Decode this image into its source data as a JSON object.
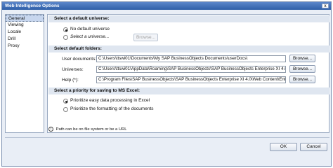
{
  "window": {
    "title": "Web Intelligence Options",
    "close_glyph": "x"
  },
  "sidebar": {
    "items": [
      {
        "label": "General"
      },
      {
        "label": "Viewing"
      },
      {
        "label": "Locale"
      },
      {
        "label": "Drill"
      },
      {
        "label": "Proxy"
      }
    ]
  },
  "universe": {
    "heading": "Select a default universe:",
    "no_default_label": "No default universe",
    "select_label": "Select a universe...",
    "browse_label": "Browse..."
  },
  "folders": {
    "heading": "Select default folders:",
    "rows": [
      {
        "label": "User documents:",
        "value": "C:\\Users\\ttswi01\\Documents\\My SAP BusinessObjects Documents\\userDocs\\",
        "browse": "Browse..."
      },
      {
        "label": "Universes:",
        "value": "C:\\Users\\ttswi01\\AppData\\Roaming\\SAP BusinessObjects\\SAP BusinessObjects Enterprise XI 4.0\\Univer",
        "browse": "Browse..."
      },
      {
        "label": "Help (*):",
        "value": "C:\\Program Files\\SAP BusinessObjects\\SAP BusinessObjects Enterprise XI 4.0\\Web Content\\Enterprise_",
        "browse": "Browse..."
      }
    ]
  },
  "priority": {
    "heading": "Select a priority for saving to MS Excel:",
    "opt1": "Prioritize easy data processing in Excel",
    "opt2": "Prioritize the formatting of the documents"
  },
  "note": {
    "icon": "i",
    "text": "Path can be on file system or be a URL"
  },
  "buttons": {
    "ok": "OK",
    "cancel": "Cancel"
  }
}
